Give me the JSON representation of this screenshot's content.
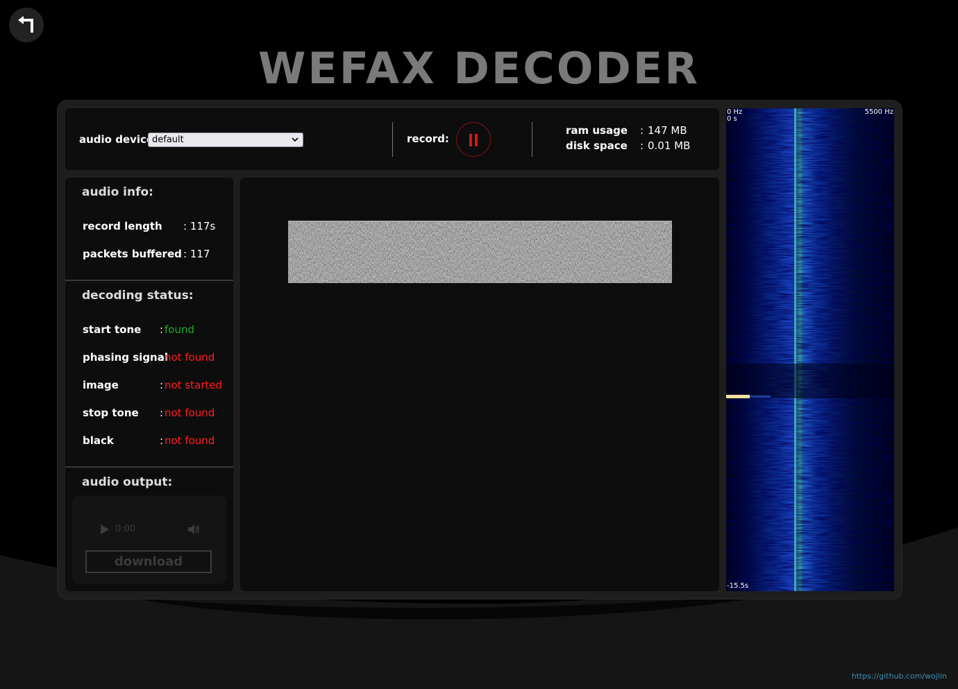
{
  "app": {
    "title": "WEFAX DECODER"
  },
  "nav": {
    "back_icon": "back-arrow-icon"
  },
  "topbar": {
    "audio_device_label": "audio device:",
    "audio_device_value": "default",
    "record_label": "record:",
    "record_state": "recording",
    "ram_usage_label": "ram usage",
    "ram_usage_value": "147 MB",
    "disk_space_label": "disk space",
    "disk_space_value": "0.01 MB",
    "separator": ":"
  },
  "audio_info": {
    "title": "audio info:",
    "rows": [
      {
        "label": "record length",
        "value": ": 117s"
      },
      {
        "label": "packets buffered",
        "value": ": 117"
      }
    ]
  },
  "decoding_status": {
    "title": "decoding status:",
    "separator": ":",
    "rows": [
      {
        "label": "start tone",
        "value": "found",
        "state": "ok"
      },
      {
        "label": "phasing signal",
        "value": "not found",
        "state": "pending"
      },
      {
        "label": "image",
        "value": "not started",
        "state": "pending"
      },
      {
        "label": "stop tone",
        "value": "not found",
        "state": "pending"
      },
      {
        "label": "black",
        "value": "not found",
        "state": "pending"
      }
    ]
  },
  "audio_output": {
    "title": "audio output:",
    "time": "0:00",
    "download_label": "download"
  },
  "waterfall": {
    "freq_min_label": "0 Hz",
    "freq_max_label": "5500 Hz",
    "time_top_label": "0 s",
    "time_bottom_label": "-15.5s"
  },
  "footer": {
    "link_text": "https://github.com/wojlin"
  },
  "colors": {
    "accent_red": "#d01818",
    "status_found": "#22aa22",
    "status_not_found": "#ff2020",
    "title_gray": "#7a7a7a",
    "link_blue": "#3c8fb0"
  }
}
